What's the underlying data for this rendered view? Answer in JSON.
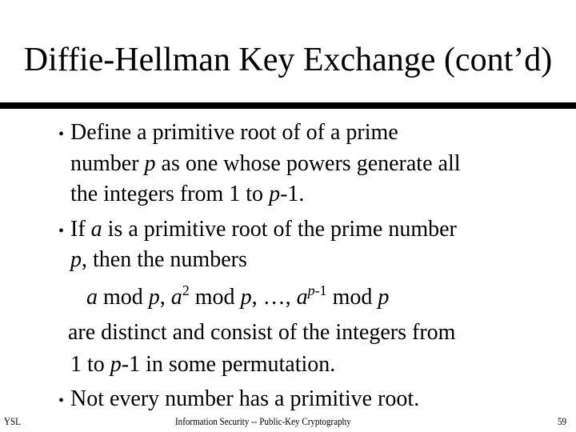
{
  "slide": {
    "title": "Diffie-Hellman Key Exchange (cont’d)",
    "bullets": [
      {
        "lines": [
          "Define a primitive root of of a prime",
          [
            "number ",
            {
              "i": "p"
            },
            " as one whose powers generate all"
          ],
          [
            "the integers from 1 to ",
            {
              "i": "p"
            },
            "-1."
          ]
        ]
      },
      {
        "lines": [
          [
            "If ",
            {
              "i": "a"
            },
            " is a primitive root of the prime number"
          ],
          [
            {
              "i": "p"
            },
            ", then the numbers"
          ],
          [
            {
              "i": "a"
            },
            " mod ",
            {
              "i": "p"
            },
            ", ",
            {
              "i": "a"
            },
            {
              "sup": "2"
            },
            " mod ",
            {
              "i": "p"
            },
            ", …, ",
            {
              "i": "a"
            },
            {
              "sup": "p-1"
            },
            " mod ",
            {
              "i": "p"
            }
          ],
          "are distinct and consist of the integers from",
          [
            "1 to ",
            {
              "i": "p"
            },
            "-1 in some permutation."
          ]
        ]
      },
      {
        "lines": [
          "Not every number has a primitive root."
        ]
      }
    ],
    "bullet_glyph": "•"
  },
  "footer": {
    "left": "YSL",
    "center": "Information Security -- Public-Key Cryptography",
    "page_number": "59"
  }
}
